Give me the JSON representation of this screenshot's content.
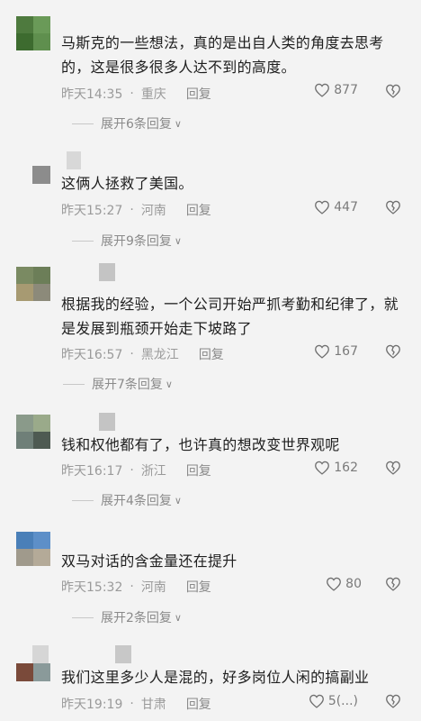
{
  "comments": [
    {
      "text": "马斯克的一些想法，真的是出自人类的角度去思考的，这是很多很多人达不到的高度。",
      "time": "昨天14:35",
      "location": "重庆",
      "reply": "回复",
      "likes": "877",
      "expand": "展开6条回复"
    },
    {
      "text": "这俩人拯救了美国。",
      "time": "昨天15:27",
      "location": "河南",
      "reply": "回复",
      "likes": "447",
      "expand": "展开9条回复"
    },
    {
      "text": "根据我的经验，一个公司开始严抓考勤和纪律了，就是发展到瓶颈开始走下坡路了",
      "time": "昨天16:57",
      "location": "黑龙江",
      "reply": "回复",
      "likes": "167",
      "expand": "展开7条回复"
    },
    {
      "text": "钱和权他都有了，也许真的想改变世界观呢",
      "time": "昨天16:17",
      "location": "浙江",
      "reply": "回复",
      "likes": "162",
      "expand": "展开4条回复"
    },
    {
      "text": "双马对话的含金量还在提升",
      "time": "昨天15:32",
      "location": "河南",
      "reply": "回复",
      "likes": "80",
      "expand": "展开2条回复"
    },
    {
      "text": "我们这里多少人是混的，好多岗位人闲的搞副业",
      "time": "昨天19:19",
      "location": "甘肃",
      "reply": "回复",
      "likes": "5(...)"
    }
  ],
  "icons": {
    "like": "heart-outline-icon",
    "dislike": "broken-heart-icon",
    "expand": "chevron-down-icon"
  },
  "colors": {
    "background": "#f3f3f3",
    "meta_text": "#9a9a9a",
    "body_text": "#1e1e1e"
  }
}
